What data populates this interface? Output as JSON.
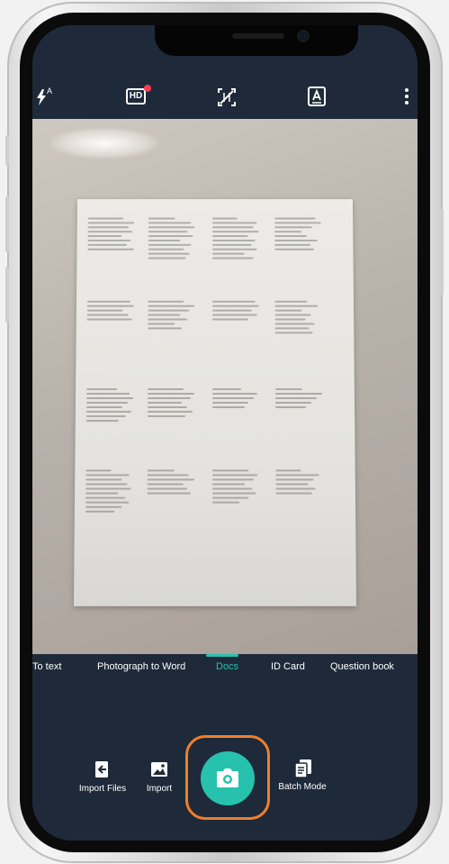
{
  "topbar": {
    "flash_mode": "A",
    "hd_label": "HD",
    "icons": [
      "flash-auto-icon",
      "hd-icon",
      "grid-off-icon",
      "text-mode-icon",
      "more-icon"
    ]
  },
  "modes": {
    "items": [
      "To text",
      "Photograph to Word",
      "Docs",
      "ID Card",
      "Question book"
    ],
    "active": "Docs"
  },
  "actions": {
    "import_files": "Import Files",
    "import": "Import",
    "batch_mode": "Batch Mode"
  },
  "colors": {
    "background": "#1e2a3a",
    "accent": "#27c2ae",
    "shutter_outline": "#f07f2a"
  }
}
